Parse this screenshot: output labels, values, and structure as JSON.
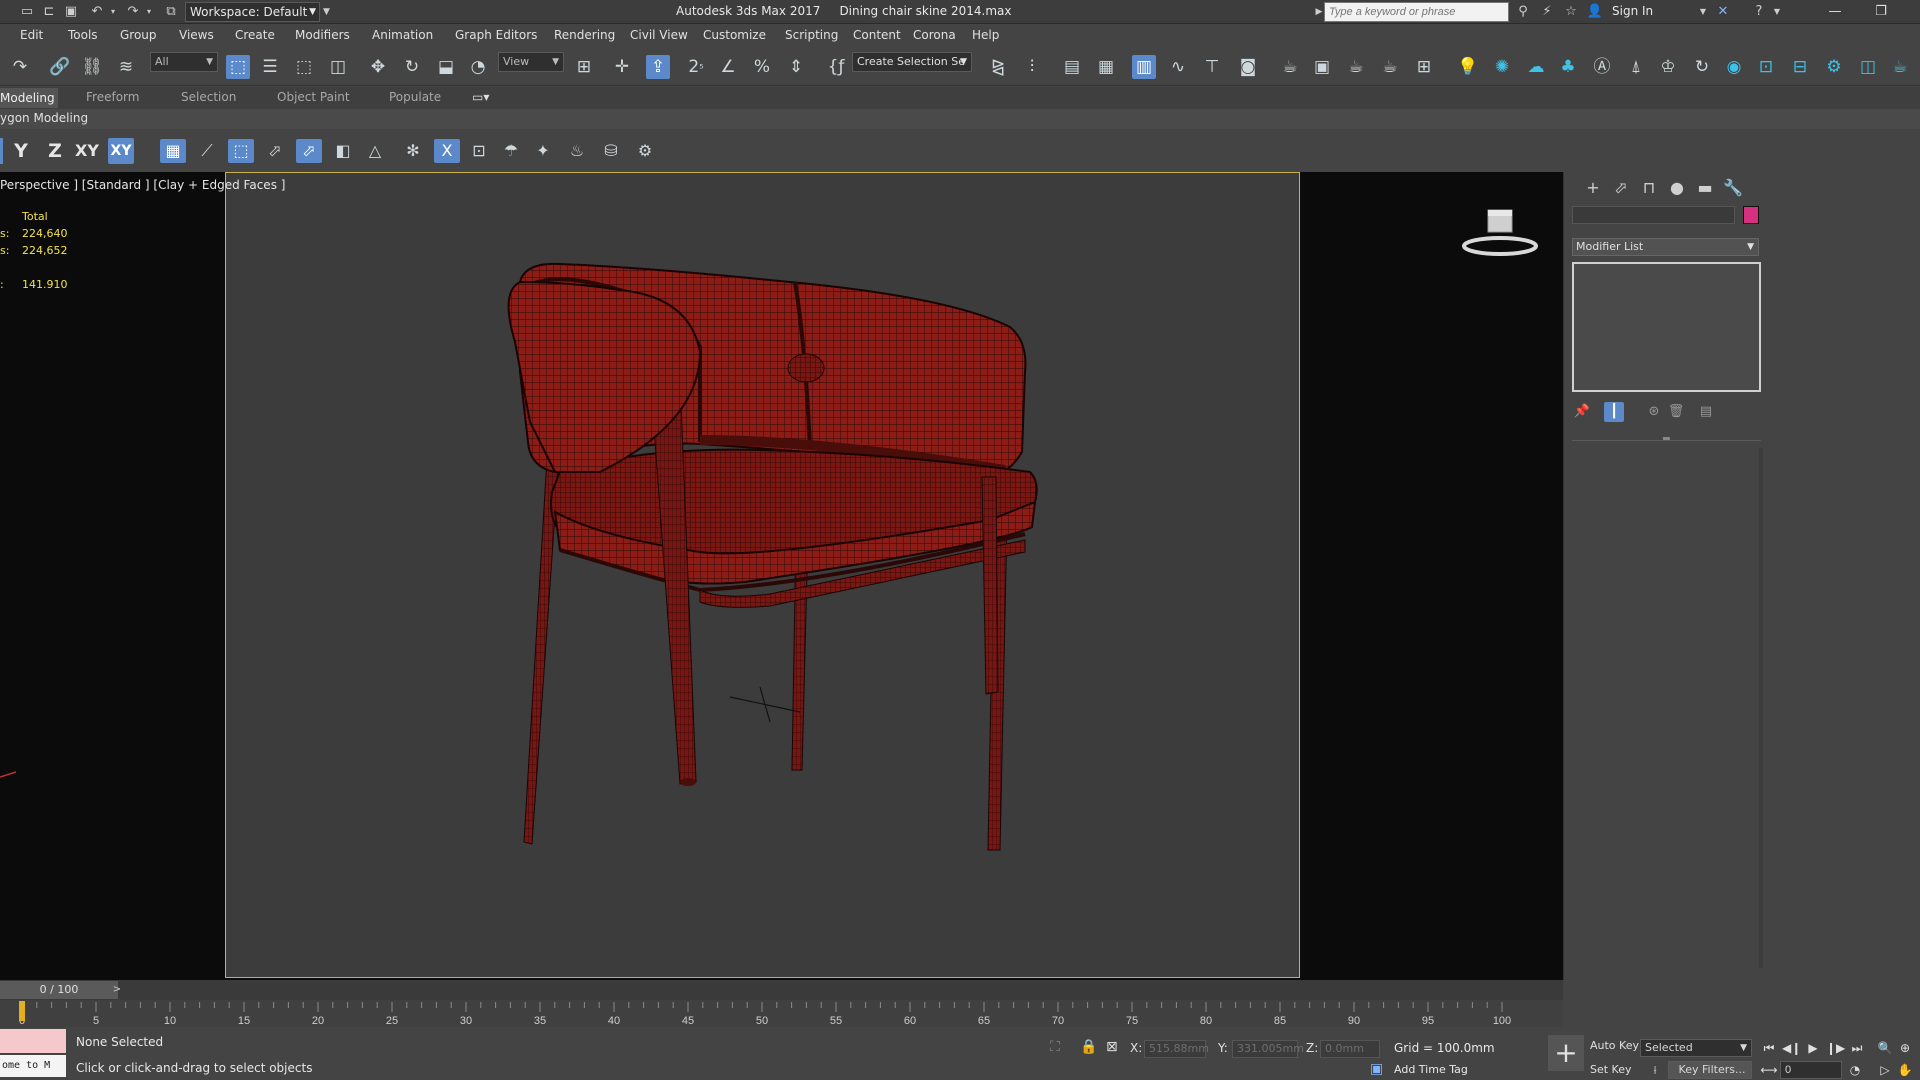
{
  "window": {
    "app_title": "Autodesk 3ds Max 2017",
    "file_name": "Dining chair skine 2014.max",
    "workspace_label": "Workspace: Default",
    "search_placeholder": "Type a keyword or phrase",
    "sign_in": "Sign In"
  },
  "menu": [
    "Edit",
    "Tools",
    "Group",
    "Views",
    "Create",
    "Modifiers",
    "Animation",
    "Graph Editors",
    "Rendering",
    "Civil View",
    "Customize",
    "Scripting",
    "Content",
    "Corona",
    "Help"
  ],
  "toolbar": {
    "filter_value": "All",
    "ref_coord_value": "View",
    "selection_set_value": "Create Selection Se"
  },
  "ribbon": {
    "tabs": [
      "Modeling",
      "Freeform",
      "Selection",
      "Object Paint",
      "Populate"
    ],
    "active_tab": "Modeling",
    "panel_title": "ygon Modeling"
  },
  "axis_constraints": [
    "Y",
    "Z",
    "XY",
    "XY"
  ],
  "viewport": {
    "label": "Perspective ] [Standard ] [Clay + Edged Faces ]",
    "stats_header": "Total",
    "stats": [
      {
        "key": "s:",
        "value": "224,640"
      },
      {
        "key": "s:",
        "value": "224,652"
      },
      {
        "key": "",
        "value": ""
      },
      {
        "key": ":",
        "value": "141.910"
      }
    ],
    "mesh_color": "#8b1c16",
    "wire_color": "#2a0806",
    "frame_color": "#c8b44a"
  },
  "command_panel": {
    "modifier_list": "Modifier List",
    "object_color": "#d6307e"
  },
  "timeline": {
    "frame_display": "0 / 100",
    "ticks": [
      "0",
      "5",
      "10",
      "15",
      "20",
      "25",
      "30",
      "35",
      "40",
      "45",
      "50",
      "55",
      "60",
      "65",
      "70",
      "75",
      "80",
      "85",
      "90",
      "95",
      "100"
    ]
  },
  "status": {
    "maxscript_text": "ome to M",
    "selection_status": "None Selected",
    "prompt": "Click or click-and-drag to select objects",
    "x_label": "X:",
    "x_value": "515.88mm",
    "y_label": "Y:",
    "y_value": "331.005mm",
    "z_label": "Z:",
    "z_value": "0.0mm",
    "grid": "Grid = 100.0mm",
    "add_time_tag": "Add Time Tag"
  },
  "animation": {
    "auto_key": "Auto Key",
    "set_key": "Set Key",
    "selected_value": "Selected",
    "key_filters": "Key Filters...",
    "current_frame": "0"
  }
}
